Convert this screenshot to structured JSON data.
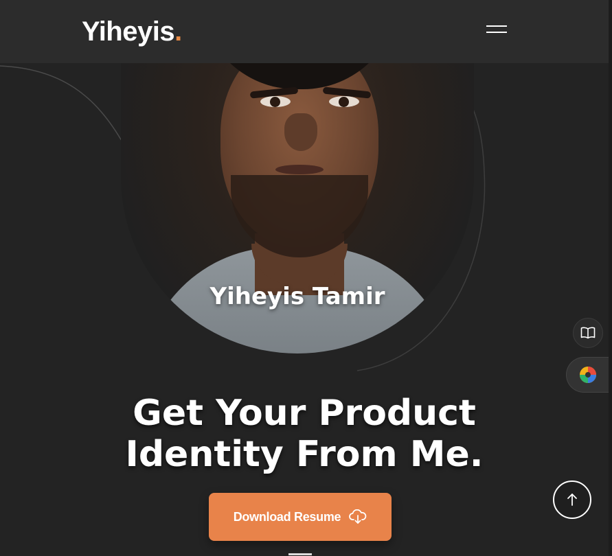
{
  "header": {
    "logo_text": "Yiheyis",
    "logo_dot": ".",
    "menu_icon": "hamburger-menu-icon"
  },
  "hero": {
    "portrait_name": "Yiheyis Tamir",
    "headline_line1": "Get Your Product",
    "headline_line2": "Identity From Me.",
    "cta_label": "Download Resume",
    "cta_icon": "cloud-download-icon"
  },
  "floating": {
    "book_icon": "open-book-icon",
    "theme_icon": "color-palette-icon",
    "scroll_top_icon": "arrow-up-icon"
  },
  "colors": {
    "background": "#232323",
    "header": "#2c2c2c",
    "accent": "#e8834a"
  }
}
